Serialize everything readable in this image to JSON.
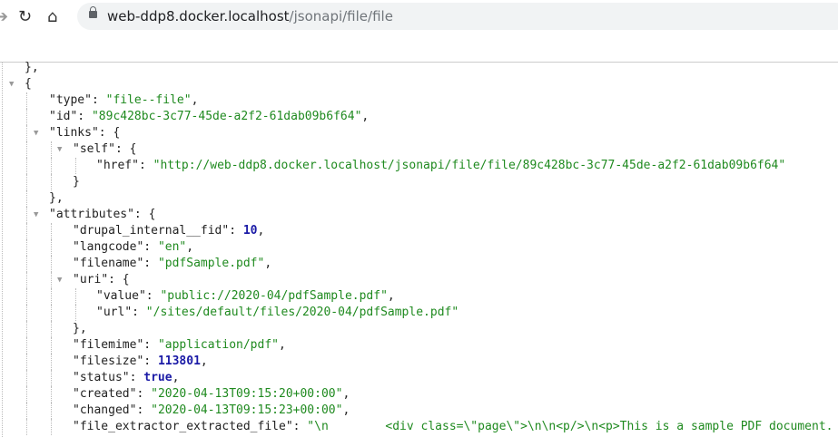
{
  "browser": {
    "url_host": "web-ddp8.docker.localhost",
    "url_path": "/jsonapi/file/file"
  },
  "lines": [
    {
      "d": 1,
      "p": "},"
    },
    {
      "d": 1,
      "p": "{",
      "open": true
    },
    {
      "d": 2,
      "k": "type",
      "v": "file--file",
      "t": "s",
      "c": ","
    },
    {
      "d": 2,
      "k": "id",
      "v": "89c428bc-3c77-45de-a2f2-61dab09b6f64",
      "t": "s",
      "c": ","
    },
    {
      "d": 2,
      "k": "links",
      "p": "{",
      "open": true
    },
    {
      "d": 3,
      "k": "self",
      "p": "{",
      "open": true
    },
    {
      "d": 4,
      "k": "href",
      "v": "http://web-ddp8.docker.localhost/jsonapi/file/file/89c428bc-3c77-45de-a2f2-61dab09b6f64",
      "t": "s"
    },
    {
      "d": 3,
      "p": "}"
    },
    {
      "d": 2,
      "p": "},"
    },
    {
      "d": 2,
      "k": "attributes",
      "p": "{",
      "open": true
    },
    {
      "d": 3,
      "k": "drupal_internal__fid",
      "v": "10",
      "t": "n",
      "c": ","
    },
    {
      "d": 3,
      "k": "langcode",
      "v": "en",
      "t": "s",
      "c": ","
    },
    {
      "d": 3,
      "k": "filename",
      "v": "pdfSample.pdf",
      "t": "s",
      "c": ","
    },
    {
      "d": 3,
      "k": "uri",
      "p": "{",
      "open": true
    },
    {
      "d": 4,
      "k": "value",
      "v": "public://2020-04/pdfSample.pdf",
      "t": "s",
      "c": ","
    },
    {
      "d": 4,
      "k": "url",
      "v": "/sites/default/files/2020-04/pdfSample.pdf",
      "t": "s"
    },
    {
      "d": 3,
      "p": "},"
    },
    {
      "d": 3,
      "k": "filemime",
      "v": "application/pdf",
      "t": "s",
      "c": ","
    },
    {
      "d": 3,
      "k": "filesize",
      "v": "113801",
      "t": "n",
      "c": ","
    },
    {
      "d": 3,
      "k": "status",
      "v": "true",
      "t": "n",
      "c": ","
    },
    {
      "d": 3,
      "k": "created",
      "v": "2020-04-13T09:15:20+00:00",
      "t": "s",
      "c": ","
    },
    {
      "d": 3,
      "k": "changed",
      "v": "2020-04-13T09:15:23+00:00",
      "t": "s",
      "c": ","
    },
    {
      "d": 3,
      "k": "file_extractor_extracted_file",
      "v": "\\n        <div class=\\\"page\\\">\\n\\n<p/>\\n<p>This is a sample PDF document.",
      "t": "s",
      "open_str": true
    }
  ]
}
